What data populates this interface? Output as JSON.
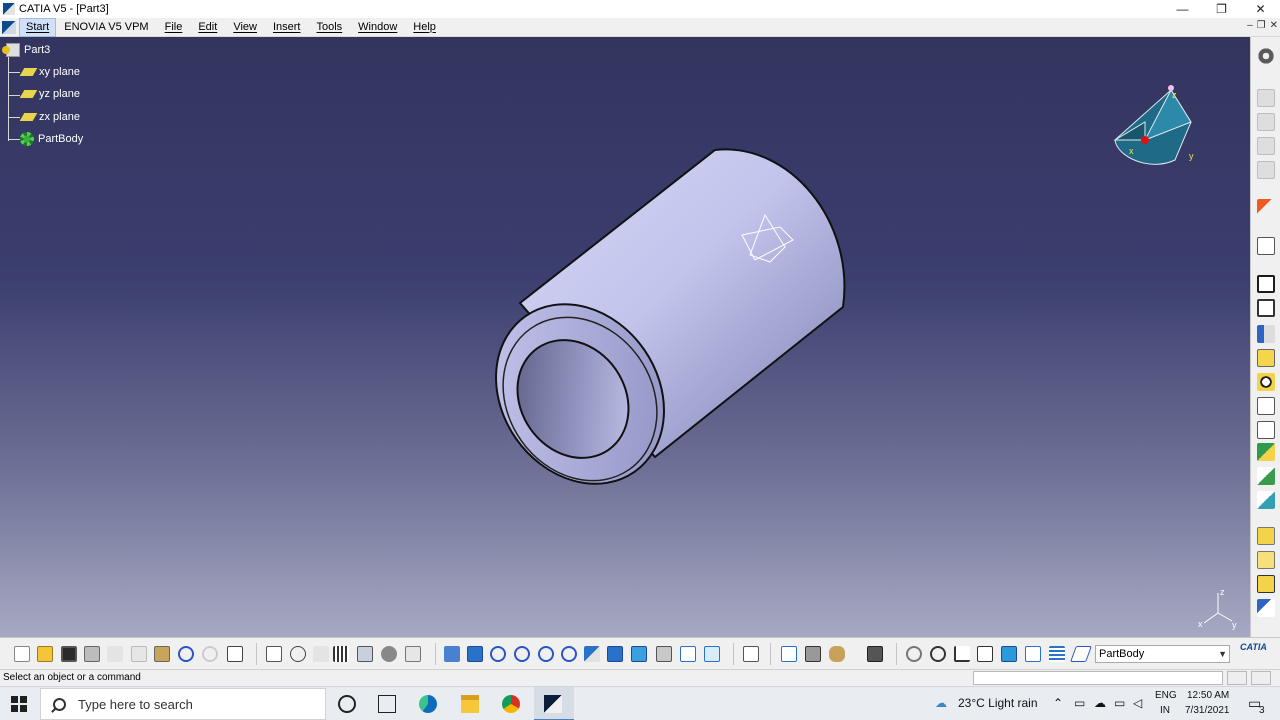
{
  "window": {
    "title": "CATIA V5 - [Part3]"
  },
  "window_controls": {
    "minimize": "—",
    "restore": "❐",
    "close": "✕"
  },
  "menu": {
    "items": [
      "Start",
      "ENOVIA V5 VPM",
      "File",
      "Edit",
      "View",
      "Insert",
      "Tools",
      "Window",
      "Help"
    ],
    "doc_controls": {
      "minimize": "–",
      "restore": "❐",
      "close": "✕"
    }
  },
  "tree": {
    "root": "Part3",
    "items": [
      {
        "label": "xy plane",
        "icon": "plane-icon"
      },
      {
        "label": "yz plane",
        "icon": "plane-icon"
      },
      {
        "label": "zx plane",
        "icon": "plane-icon"
      },
      {
        "label": "PartBody",
        "icon": "gear-icon"
      }
    ]
  },
  "compass": {
    "x": "x",
    "y": "y",
    "z": "z"
  },
  "axes": {
    "x": "x",
    "y": "y",
    "z": "z"
  },
  "bottom_toolbar": {
    "current_body": "PartBody",
    "logo": "CATIA"
  },
  "status": {
    "message": "Select an object or a command"
  },
  "taskbar": {
    "search_placeholder": "Type here to search",
    "weather": "23°C  Light rain",
    "lang_top": "ENG",
    "lang_bottom": "IN",
    "time": "12:50 AM",
    "date": "7/31/2021",
    "notifications": "3"
  },
  "colors": {
    "viewport_top": "#33355f",
    "viewport_bottom": "#a7a9c3",
    "part_fill": "#b9bbe6",
    "accent": "#0b4a8e"
  }
}
